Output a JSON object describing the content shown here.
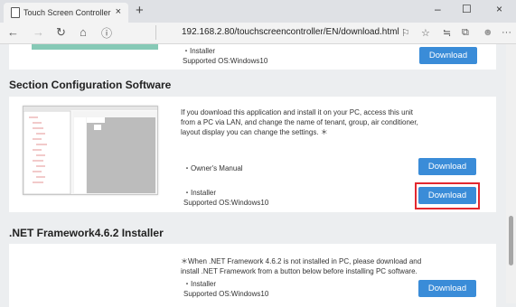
{
  "browser": {
    "tab_title": "Touch Screen Controller",
    "tab_close": "×",
    "new_tab": "+",
    "url": "192.168.2.80/touchscreencontroller/EN/download.html",
    "window_controls": {
      "minimize": "–",
      "maximize": "☐",
      "close": "×"
    },
    "nav_icons": {
      "back": "←",
      "forward": "→",
      "refresh": "↻",
      "home": "⌂",
      "info": "ⓘ"
    },
    "toolbar_icons": {
      "read_aloud": "⚐",
      "favorite": "☆",
      "favorites": "≒",
      "collections": "⧉",
      "profile": "☻",
      "menu": "···"
    }
  },
  "top_section": {
    "installer_label": "・Installer",
    "supported_os": "Supported OS:Windows10",
    "download_label": "Download"
  },
  "section_config": {
    "title": "Section Configuration Software",
    "description_lines": [
      "If you download this application and install it on your PC, access this unit",
      "from a PC via LAN, and change the name of tenant, group, air conditioner,",
      "layout display you can change the settings. ＊"
    ],
    "manual_label": "・Owner's Manual",
    "manual_download": "Download",
    "installer_label": "・Installer",
    "supported_os": "Supported OS:Windows10",
    "installer_download": "Download"
  },
  "section_net": {
    "title": ".NET Framework4.6.2 Installer",
    "note_lines": [
      "＊When .NET Framework 4.6.2 is not installed in PC, please download and",
      "install .NET Framework from a button below before installing PC software."
    ],
    "installer_label": "・Installer",
    "supported_os": "Supported OS:Windows10",
    "download_label": "Download"
  },
  "colors": {
    "button": "#3a8cd8",
    "highlight": "#e3282f"
  }
}
